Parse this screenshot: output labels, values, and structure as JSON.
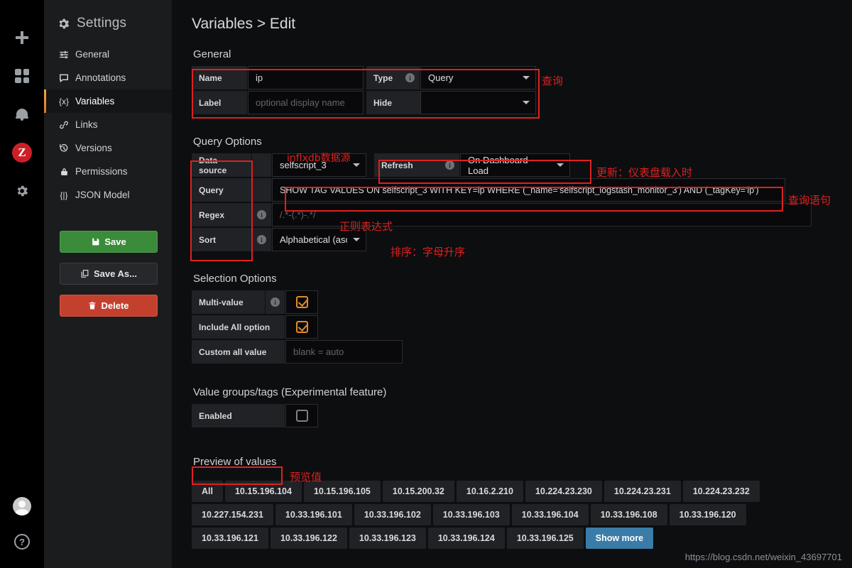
{
  "rail": {
    "items": [
      {
        "name": "add-icon",
        "glyph": "+"
      },
      {
        "name": "dashboards-icon",
        "glyph": "▦"
      },
      {
        "name": "alerting-bell-icon",
        "glyph": "🔔"
      },
      {
        "name": "zabbix-icon",
        "glyph": "Z"
      },
      {
        "name": "configuration-gear-icon",
        "glyph": "⚙"
      }
    ],
    "bottom": [
      {
        "name": "user-avatar",
        "glyph": ""
      },
      {
        "name": "help-icon",
        "glyph": "?"
      }
    ]
  },
  "sidebar": {
    "title": "Settings",
    "items": [
      {
        "label": "General",
        "icon": "sliders-icon",
        "glyph": "⇄",
        "active": false
      },
      {
        "label": "Annotations",
        "icon": "comment-icon",
        "glyph": "🗩",
        "active": false
      },
      {
        "label": "Variables",
        "icon": "variable-icon",
        "glyph": "{x}",
        "active": true
      },
      {
        "label": "Links",
        "icon": "link-icon",
        "glyph": "🔗",
        "active": false
      },
      {
        "label": "Versions",
        "icon": "history-icon",
        "glyph": "↺",
        "active": false
      },
      {
        "label": "Permissions",
        "icon": "lock-icon",
        "glyph": "🔒",
        "active": false
      },
      {
        "label": "JSON Model",
        "icon": "braces-icon",
        "glyph": "{|}",
        "active": false
      }
    ],
    "buttons": {
      "save": "Save",
      "save_icon": "💾",
      "save_as": "Save As...",
      "save_as_icon": "❐",
      "delete": "Delete",
      "delete_icon": "🗑"
    }
  },
  "main": {
    "page_title": "Variables > Edit",
    "general": {
      "section_title": "General",
      "name_label": "Name",
      "name_value": "ip",
      "type_label": "Type",
      "type_value": "Query",
      "label_label": "Label",
      "label_placeholder": "optional display name",
      "hide_label": "Hide",
      "hide_value": ""
    },
    "query_options": {
      "section_title": "Query Options",
      "datasource_label": "Data source",
      "datasource_value": "selfscript_3",
      "refresh_label": "Refresh",
      "refresh_value": "On Dashboard Load",
      "query_label": "Query",
      "query_value": "SHOW TAG VALUES ON selfscript_3 WITH KEY=ip WHERE (_name='selfscript_logstash_monitor_3') AND (_tagKey='ip')",
      "regex_label": "Regex",
      "regex_placeholder": "/.*-(.*)-.*/",
      "sort_label": "Sort",
      "sort_value": "Alphabetical (asc)"
    },
    "selection_options": {
      "section_title": "Selection Options",
      "multi_value_label": "Multi-value",
      "multi_value_checked": true,
      "include_all_label": "Include All option",
      "include_all_checked": true,
      "custom_all_label": "Custom all value",
      "custom_all_placeholder": "blank = auto"
    },
    "value_groups": {
      "section_title": "Value groups/tags (Experimental feature)",
      "enabled_label": "Enabled",
      "enabled_checked": false
    },
    "preview": {
      "section_title": "Preview of values",
      "values": [
        "All",
        "10.15.196.104",
        "10.15.196.105",
        "10.15.200.32",
        "10.16.2.210",
        "10.224.23.230",
        "10.224.23.231",
        "10.224.23.232",
        "10.227.154.231",
        "10.33.196.101",
        "10.33.196.102",
        "10.33.196.103",
        "10.33.196.104",
        "10.33.196.108",
        "10.33.196.120",
        "10.33.196.121",
        "10.33.196.122",
        "10.33.196.123",
        "10.33.196.124",
        "10.33.196.125"
      ],
      "show_more": "Show more"
    }
  },
  "annotations": {
    "type_note": "查询",
    "datasource_note": "inflxdb数据源",
    "refresh_note": "更新：仪表盘载入时",
    "query_note": "查询语句",
    "regex_note": "正则表达式",
    "sort_note": "排序：字母升序",
    "preview_note": "预览值"
  },
  "watermark": "https://blog.csdn.net/weixin_43697701",
  "colors": {
    "accent_orange": "#e08b2e",
    "annotation_red": "#e02020",
    "save_green": "#3a8b3a",
    "delete_red": "#c4402e",
    "show_more_blue": "#3b7ba8",
    "zabbix_red": "#cc2029"
  }
}
